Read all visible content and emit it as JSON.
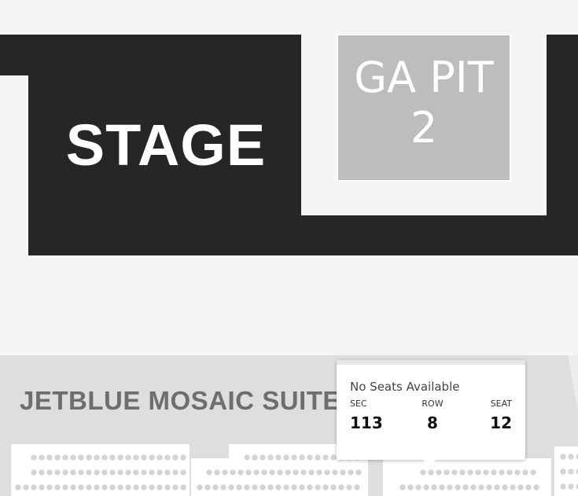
{
  "venue_map": {
    "stage_label": "STAGE",
    "ga_pit": {
      "label": "GA PIT",
      "number": "2"
    },
    "suite_label": "JETBLUE MOSAIC SUITES"
  },
  "tooltip": {
    "status": "No Seats Available",
    "columns": [
      {
        "label": "SEC",
        "value": "113"
      },
      {
        "label": "ROW",
        "value": "8"
      },
      {
        "label": "SEAT",
        "value": "12"
      }
    ]
  },
  "colors": {
    "stage": "#262626",
    "ga_pit": "#bdbdbd",
    "suite_band": "#dedede",
    "background": "#f5f5f5",
    "seat_dot": "#d4d4d4"
  }
}
